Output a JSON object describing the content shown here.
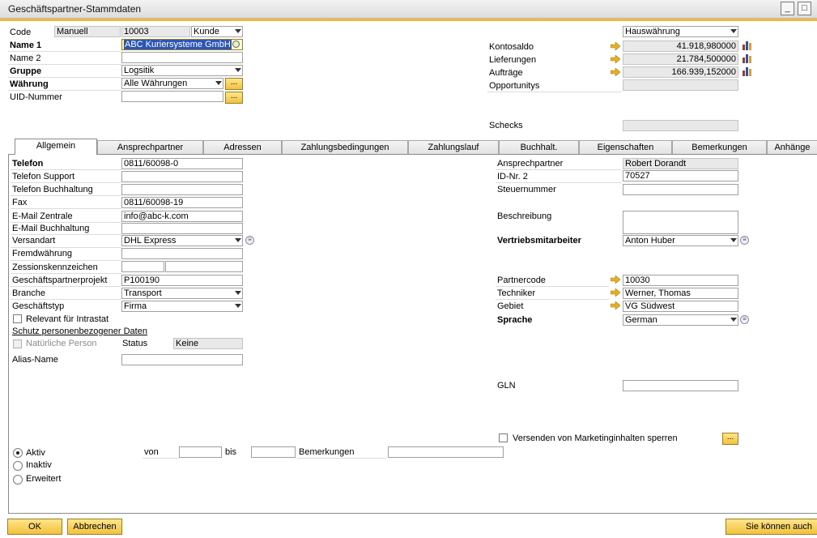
{
  "window": {
    "title": "Geschäftspartner-Stammdaten"
  },
  "header": {
    "code_label": "Code",
    "code_series": "Manuell",
    "code_value": "10003",
    "code_type": "Kunde",
    "name1_label": "Name 1",
    "name1_value": "ABC Kuriersysteme GmbH",
    "name2_label": "Name 2",
    "name2_value": "",
    "gruppe_label": "Gruppe",
    "gruppe_value": "Logsitik",
    "waehrung_label": "Währung",
    "waehrung_value": "Alle Währungen",
    "uid_label": "UID-Nummer",
    "uid_value": "",
    "currency_select": "Hauswährung",
    "kontosaldo_label": "Kontosaldo",
    "kontosaldo_value": "41.918,980000",
    "lieferungen_label": "Lieferungen",
    "lieferungen_value": "21.784,500000",
    "auftraege_label": "Aufträge",
    "auftraege_value": "166.939,152000",
    "opportunitys_label": "Opportunitys",
    "opportunitys_value": "",
    "schecks_label": "Schecks",
    "schecks_value": "",
    "ellipsis": "..."
  },
  "tabs": [
    "Allgemein",
    "Ansprechpartner",
    "Adressen",
    "Zahlungsbedingungen",
    "Zahlungslauf",
    "Buchhalt.",
    "Eigenschaften",
    "Bemerkungen",
    "Anhänge"
  ],
  "general": {
    "telefon_label": "Telefon",
    "telefon_value": "0811/60098-0",
    "telefon_support_label": "Telefon Support",
    "telefon_support_value": "",
    "telefon_buchhaltung_label": "Telefon Buchhaltung",
    "telefon_buchhaltung_value": "",
    "fax_label": "Fax",
    "fax_value": "0811/60098-19",
    "email_zentrale_label": "E-Mail Zentrale",
    "email_zentrale_value": "info@abc-k.com",
    "email_buchhaltung_label": "E-Mail Buchhaltung",
    "email_buchhaltung_value": "",
    "versandart_label": "Versandart",
    "versandart_value": "DHL Express",
    "fremdwaehrung_label": "Fremdwährung",
    "fremdwaehrung_value": "",
    "zession_label": "Zessionskennzeichen",
    "projekt_label": "Geschäftspartnerprojekt",
    "projekt_value": "P100190",
    "branche_label": "Branche",
    "branche_value": "Transport",
    "geschaeftstyp_label": "Geschäftstyp",
    "geschaeftstyp_value": "Firma",
    "intrastat_label": "Relevant für Intrastat",
    "schutz_label": "Schutz personenbezogener Daten",
    "natuerliche_label": "Natürliche Person",
    "status_label": "Status",
    "status_value": "Keine",
    "alias_label": "Alias-Name",
    "alias_value": "",
    "ansprechpartner_label": "Ansprechpartner",
    "ansprechpartner_value": "Robert Dorandt",
    "idnr2_label": "ID-Nr. 2",
    "idnr2_value": "70527",
    "steuernummer_label": "Steuernummer",
    "steuernummer_value": "",
    "beschreibung_label": "Beschreibung",
    "beschreibung_value": "",
    "vertrieb_label": "Vertriebsmitarbeiter",
    "vertrieb_value": "Anton Huber",
    "partnercode_label": "Partnercode",
    "partnercode_value": "10030",
    "techniker_label": "Techniker",
    "techniker_value": "Werner, Thomas",
    "gebiet_label": "Gebiet",
    "gebiet_value": "VG Südwest",
    "sprache_label": "Sprache",
    "sprache_value": "German",
    "gln_label": "GLN",
    "gln_value": "",
    "marketing_label": "Versenden von Marketinginhalten sperren",
    "aktiv_label": "Aktiv",
    "inaktiv_label": "Inaktiv",
    "erweitert_label": "Erweitert",
    "von_label": "von",
    "bis_label": "bis",
    "bemerkungen_label": "Bemerkungen"
  },
  "footer": {
    "ok": "OK",
    "abbrechen": "Abbrechen",
    "sie_koennen": "Sie können auch"
  },
  "colors": {
    "accent": "#f0b93e",
    "selection": "#2b56b5",
    "readonly": "#e9e9e9"
  }
}
